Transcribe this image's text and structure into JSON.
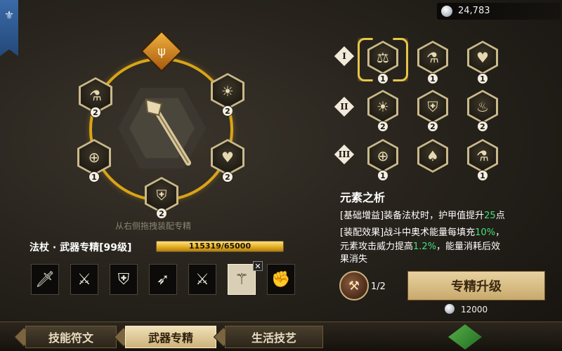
{
  "currency": {
    "value": "24,783"
  },
  "ring": {
    "nodes": [
      {
        "name": "potion",
        "icon": "⚗",
        "count": "2"
      },
      {
        "name": "sun-creature",
        "icon": "☀",
        "count": "2"
      },
      {
        "name": "crosshair",
        "icon": "⊕",
        "count": "1"
      },
      {
        "name": "heart",
        "icon": "♥",
        "count": "2"
      },
      {
        "name": "shield",
        "icon": "⛨",
        "count": "2"
      }
    ],
    "drag_hint": "从右侧拖拽装配专精"
  },
  "spec": {
    "label": "法杖 · 武器专精[99级]",
    "progress_text": "115319/65000",
    "progress": 1.0
  },
  "weapons": [
    {
      "name": "dagger",
      "icon": "🗡"
    },
    {
      "name": "short-sword",
      "icon": "⚔"
    },
    {
      "name": "shield-bow",
      "icon": "⛨"
    },
    {
      "name": "bow",
      "icon": "➶"
    },
    {
      "name": "crossed-swords",
      "icon": "⚔"
    },
    {
      "name": "staff",
      "icon": "⚚"
    },
    {
      "name": "gauntlet",
      "icon": "✊"
    }
  ],
  "tiers": [
    {
      "label": "I",
      "items": [
        {
          "icon": "⚖",
          "count": "1"
        },
        {
          "icon": "⚗",
          "count": "1"
        },
        {
          "icon": "♥",
          "count": "1"
        }
      ]
    },
    {
      "label": "II",
      "items": [
        {
          "icon": "☀",
          "count": "2"
        },
        {
          "icon": "⛨",
          "count": "2"
        },
        {
          "icon": "♨",
          "count": "2"
        }
      ]
    },
    {
      "label": "III",
      "items": [
        {
          "icon": "⊕",
          "count": "1"
        },
        {
          "icon": "♠",
          "count": ""
        },
        {
          "icon": "⚗",
          "count": "1"
        }
      ]
    }
  ],
  "detail": {
    "title": "元素之析",
    "line1_prefix": "[基础增益]装备法杖时，护甲值提升",
    "line1_value": "25",
    "line1_suffix": "点",
    "line2_prefix": "[装配效果]战斗中奥术能量每填充",
    "line2_value": "10%",
    "line2_suffix": "，",
    "line3_prefix": "元素攻击威力提高",
    "line3_value": "1.2%",
    "line3_suffix": "，能量消耗后效",
    "line4": "果消失"
  },
  "upgrade": {
    "material_count": "1/2",
    "button_label": "专精升级",
    "coin_cost": "12000"
  },
  "tabs": [
    {
      "label": "技能符文"
    },
    {
      "label": "武器专精"
    },
    {
      "label": "生活技艺"
    }
  ]
}
